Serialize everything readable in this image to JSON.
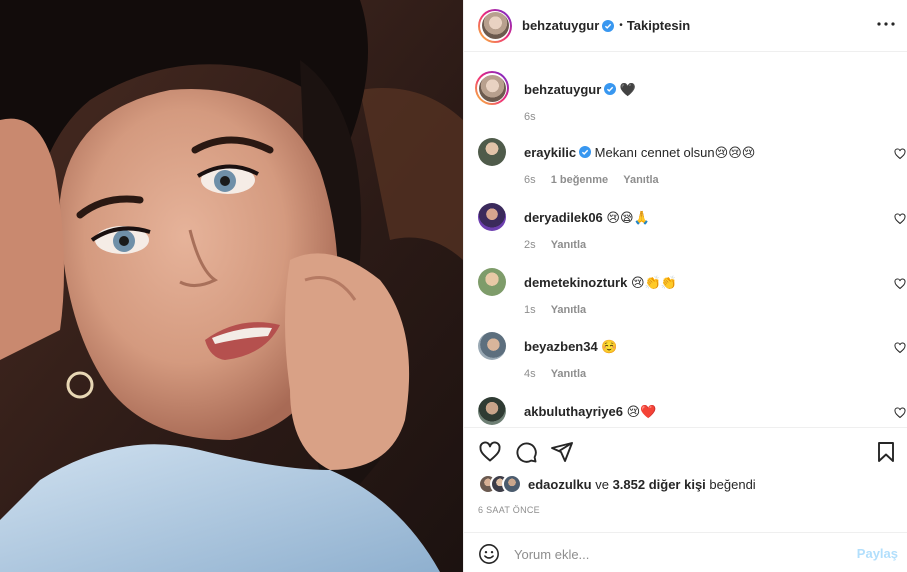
{
  "post": {
    "author": "behzatuygur",
    "follow_state": "Takiptesin",
    "more_icon": "more-horizontal-icon"
  },
  "caption": {
    "username": "behzatuygur",
    "text": "🖤",
    "time": "6s"
  },
  "comments": [
    {
      "username": "eraykilic",
      "verified": true,
      "text": "Mekanı cennet olsun😢😢😢",
      "time": "6s",
      "likes": "1 beğenme",
      "reply": "Yanıtla"
    },
    {
      "username": "deryadilek06",
      "verified": false,
      "text": "😢😪🙏",
      "time": "2s",
      "likes": "",
      "reply": "Yanıtla"
    },
    {
      "username": "demetekinozturk",
      "verified": false,
      "text": "😢👏👏",
      "time": "1s",
      "likes": "",
      "reply": "Yanıtla"
    },
    {
      "username": "beyazben34",
      "verified": false,
      "text": "☺️",
      "time": "4s",
      "likes": "",
      "reply": "Yanıtla"
    },
    {
      "username": "akbuluthayriye6",
      "verified": false,
      "text": "😢❤️",
      "time": "",
      "likes": "",
      "reply": ""
    }
  ],
  "likes": {
    "user": "edaozulku",
    "connector": "ve",
    "others": "3.852 diğer kişi",
    "suffix": "beğendi"
  },
  "timestamp": "6 SAAT ÖNCE",
  "comment_box": {
    "placeholder": "Yorum ekle...",
    "post_label": "Paylaş"
  },
  "colors": {
    "verified": "#3897f0",
    "post_button_disabled": "#b2dffc",
    "text": "#262626",
    "muted": "#8e8e8e"
  }
}
